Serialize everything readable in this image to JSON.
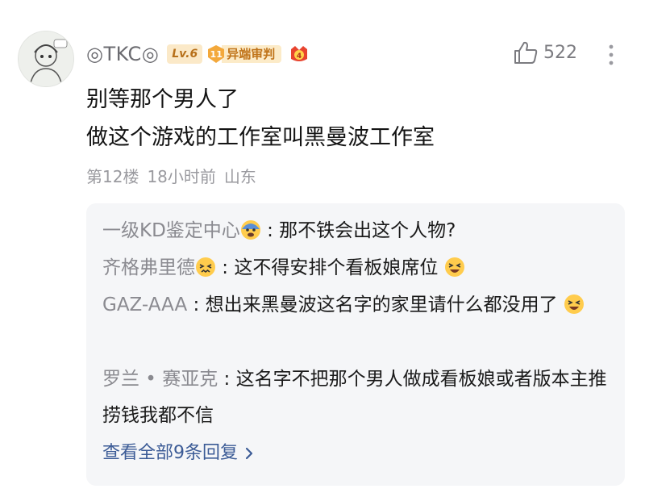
{
  "comment": {
    "username": "◎TKC◎",
    "level_badge": "Lv.6",
    "fan_level": "11",
    "fan_title": "异端审判",
    "like_count": "522",
    "lines": [
      "别等那个男人了",
      "做这个游戏的工作室叫黑曼波工作室"
    ],
    "floor": "第12楼",
    "time": "18小时前",
    "location": "山东",
    "icons": {
      "avatar": "avatar-drawing",
      "game": "game-character-icon",
      "like": "thumbs-up-icon",
      "more": "more-vertical-icon"
    },
    "colors": {
      "link": "#3b5b96",
      "badge_bg": "#fbe9c8",
      "badge_text": "#c0741a"
    }
  },
  "replies": [
    {
      "name": "一级KD鉴定中心",
      "name_emoji": "fearful-face-emoji",
      "sep": " : ",
      "text": "那不铁会出这个人物?"
    },
    {
      "name": "齐格弗里德",
      "name_emoji": "confounded-face-emoji",
      "sep": " : ",
      "text": "这不得安排个看板娘席位",
      "end_emoji": "tired-face-emoji"
    },
    {
      "name": "GAZ-AAA",
      "sep": " : ",
      "text": "想出来黑曼波这名字的家里请什么都没用了",
      "end_emoji": "tired-face-emoji"
    },
    {
      "name": "罗兰 • 赛亚克",
      "sep": " : ",
      "text": "这名字不把那个男人做成看板娘或者版本主推捞钱我都不信"
    }
  ],
  "view_all": "查看全部9条回复"
}
